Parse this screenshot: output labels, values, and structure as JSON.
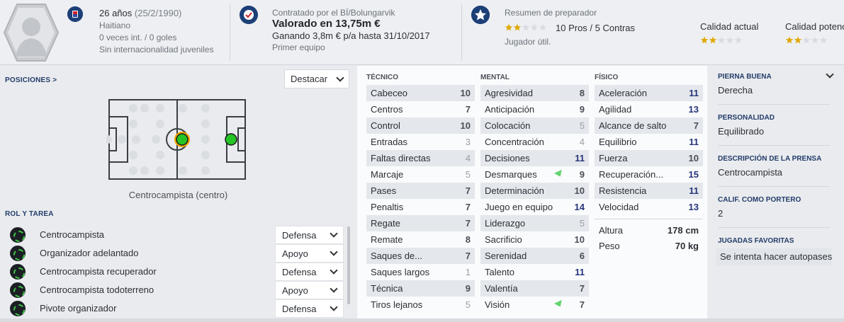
{
  "header": {
    "age": "26 años",
    "dob": "(25/2/1990)",
    "nationality": "Haitiano",
    "caps": "0 veces int. / 0 goles",
    "youth_caps": "Sin internacionalidad juveniles",
    "contracted_by": "Contratado por el BÍ/Bolungarvik",
    "value": "Valorado en 13,75m €",
    "wage": "Ganando 3,8m € p/a hasta 31/10/2017",
    "squad": "Primer equipo",
    "coach_summary_label": "Resumen de preparador",
    "pros_cons": "10 Pros / 5 Contras",
    "coach_verdict": "Jugador útil.",
    "current_ability_label": "Calidad actual",
    "potential_ability_label": "Calidad potencial",
    "coach_stars": 2,
    "current_stars": 2,
    "potential_stars": 2
  },
  "positions": {
    "label": "POSICIONES >",
    "highlight_dropdown": "Destacar",
    "position_caption": "Centrocampista (centro)"
  },
  "roles": {
    "label": "ROL Y TAREA",
    "items": [
      {
        "name": "Centrocampista",
        "duty": "Defensa"
      },
      {
        "name": "Organizador adelantado",
        "duty": "Apoyo"
      },
      {
        "name": "Centrocampista recuperador",
        "duty": "Defensa"
      },
      {
        "name": "Centrocampista todoterreno",
        "duty": "Apoyo"
      },
      {
        "name": "Pivote organizador",
        "duty": "Defensa"
      }
    ]
  },
  "attributes": {
    "technical_title": "TÉCNICO",
    "mental_title": "MENTAL",
    "physical_title": "FÍSICO",
    "technical": [
      {
        "name": "Cabeceo",
        "value": "10"
      },
      {
        "name": "Centros",
        "value": "7"
      },
      {
        "name": "Control",
        "value": "10"
      },
      {
        "name": "Entradas",
        "value": "3"
      },
      {
        "name": "Faltas directas",
        "value": "4"
      },
      {
        "name": "Marcaje",
        "value": "5"
      },
      {
        "name": "Pases",
        "value": "7"
      },
      {
        "name": "Penaltis",
        "value": "7"
      },
      {
        "name": "Regate",
        "value": "7"
      },
      {
        "name": "Remate",
        "value": "8"
      },
      {
        "name": "Saques de...",
        "value": "7"
      },
      {
        "name": "Saques largos",
        "value": "1"
      },
      {
        "name": "Técnica",
        "value": "9"
      },
      {
        "name": "Tiros lejanos",
        "value": "5"
      }
    ],
    "mental": [
      {
        "name": "Agresividad",
        "value": "8"
      },
      {
        "name": "Anticipación",
        "value": "9"
      },
      {
        "name": "Colocación",
        "value": "5"
      },
      {
        "name": "Concentración",
        "value": "4"
      },
      {
        "name": "Decisiones",
        "value": "11"
      },
      {
        "name": "Desmarques",
        "value": "9"
      },
      {
        "name": "Determinación",
        "value": "10"
      },
      {
        "name": "Juego en equipo",
        "value": "14"
      },
      {
        "name": "Liderazgo",
        "value": "5"
      },
      {
        "name": "Sacrificio",
        "value": "10"
      },
      {
        "name": "Serenidad",
        "value": "6"
      },
      {
        "name": "Talento",
        "value": "11"
      },
      {
        "name": "Valentía",
        "value": "7"
      },
      {
        "name": "Visión",
        "value": "7"
      }
    ],
    "physical": [
      {
        "name": "Aceleración",
        "value": "11"
      },
      {
        "name": "Agilidad",
        "value": "13"
      },
      {
        "name": "Alcance de salto",
        "value": "7"
      },
      {
        "name": "Equilibrio",
        "value": "11"
      },
      {
        "name": "Fuerza",
        "value": "10"
      },
      {
        "name": "Recuperación...",
        "value": "15"
      },
      {
        "name": "Resistencia",
        "value": "11"
      },
      {
        "name": "Velocidad",
        "value": "13"
      }
    ],
    "height_label": "Altura",
    "height": "178 cm",
    "weight_label": "Peso",
    "weight": "70 kg"
  },
  "info": {
    "foot_label": "PIERNA BUENA",
    "foot": "Derecha",
    "personality_label": "PERSONALIDAD",
    "personality": "Equilibrado",
    "media_label": "DESCRIPCIÓN DE LA PRENSA",
    "media": "Centrocampista",
    "gk_label": "CALIF. COMO PORTERO",
    "gk": "2",
    "ppm_label": "JUGADAS FAVORITAS",
    "ppm": "Se intenta hacer autopases"
  },
  "colors": {
    "accent_blue": "#1d3f77",
    "star_gold": "#e0a800",
    "pitch_green": "#25c425"
  }
}
